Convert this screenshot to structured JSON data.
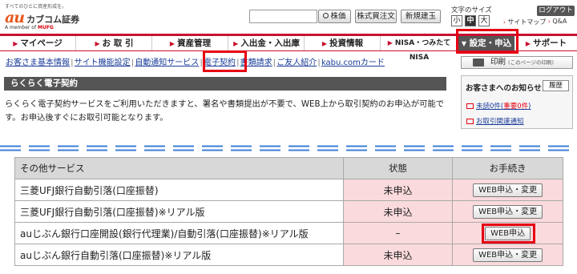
{
  "header": {
    "tagline": "すべてのひとに資産形成を。",
    "logo_au": "au",
    "logo_name": "カブコム証券",
    "logo_member": "A member of",
    "logo_mufg": "MUFG",
    "search_placeholder": "",
    "search_button": "株価",
    "stock_button": "株式買注文",
    "credit_button": "新規建玉",
    "fontsize_label": "文字のサイズ",
    "fontsize_small": "小",
    "fontsize_medium": "中",
    "fontsize_large": "大",
    "logout": "ログアウト",
    "sitemap": "サイトマップ",
    "qa": "Q&A"
  },
  "gnav": [
    {
      "label": "マイページ"
    },
    {
      "label": "お 取 引"
    },
    {
      "label": "資産管理"
    },
    {
      "label": "入出金・入出庫"
    },
    {
      "label": "投資情報"
    },
    {
      "label": "NISA・つみたてNISA"
    }
  ],
  "gnav_settings": "設定・申込",
  "gnav_support": "サポート",
  "subnav": [
    "お客さま基本情報",
    "サイト機能設定",
    "自動通知サービス",
    "電子契約",
    "書類請求",
    "ご友人紹介",
    "kabu.comカード"
  ],
  "right_panel": {
    "print_label": "印刷",
    "print_note": "(このページの印刷)",
    "notice_title": "お客さまへのお知らせ",
    "history_button": "履歴",
    "unread_prefix": "未読0件(",
    "unread_important": "重要0件",
    "unread_suffix": ")",
    "contract_notice": "お取引関連通知"
  },
  "main": {
    "section_title": "らくらく電子契約",
    "intro": "らくらく電子契約サービスをご利用いただきますと、署名や書類提出が不要で、WEB上から取引契約のお申込が可能です。お申込後すぐにお取引可能となります。"
  },
  "table": {
    "headers": [
      "その他サービス",
      "状態",
      "お手続き"
    ],
    "rows": [
      {
        "service": "三菱UFJ銀行自動引落(口座振替)",
        "status": "未申込",
        "action": "WEB申込・変更"
      },
      {
        "service": "三菱UFJ銀行自動引落(口座振替)※リアル版",
        "status": "未申込",
        "action": "WEB申込・変更"
      },
      {
        "service": "auじぶん銀行口座開設(銀行代理業)/自動引落(口座振替)※リアル版",
        "status": "–",
        "action": "WEB申込"
      },
      {
        "service": "auじぶん銀行自動引落(口座振替)※リアル版",
        "status": "未申込",
        "action": "WEB申込・変更"
      }
    ]
  },
  "colors": {
    "brand_red": "#c8102e",
    "highlight_red": "#e60012",
    "status_bg": "#fadadd",
    "link_blue": "#1a3c99",
    "dash_blue": "#3d7fd6"
  }
}
